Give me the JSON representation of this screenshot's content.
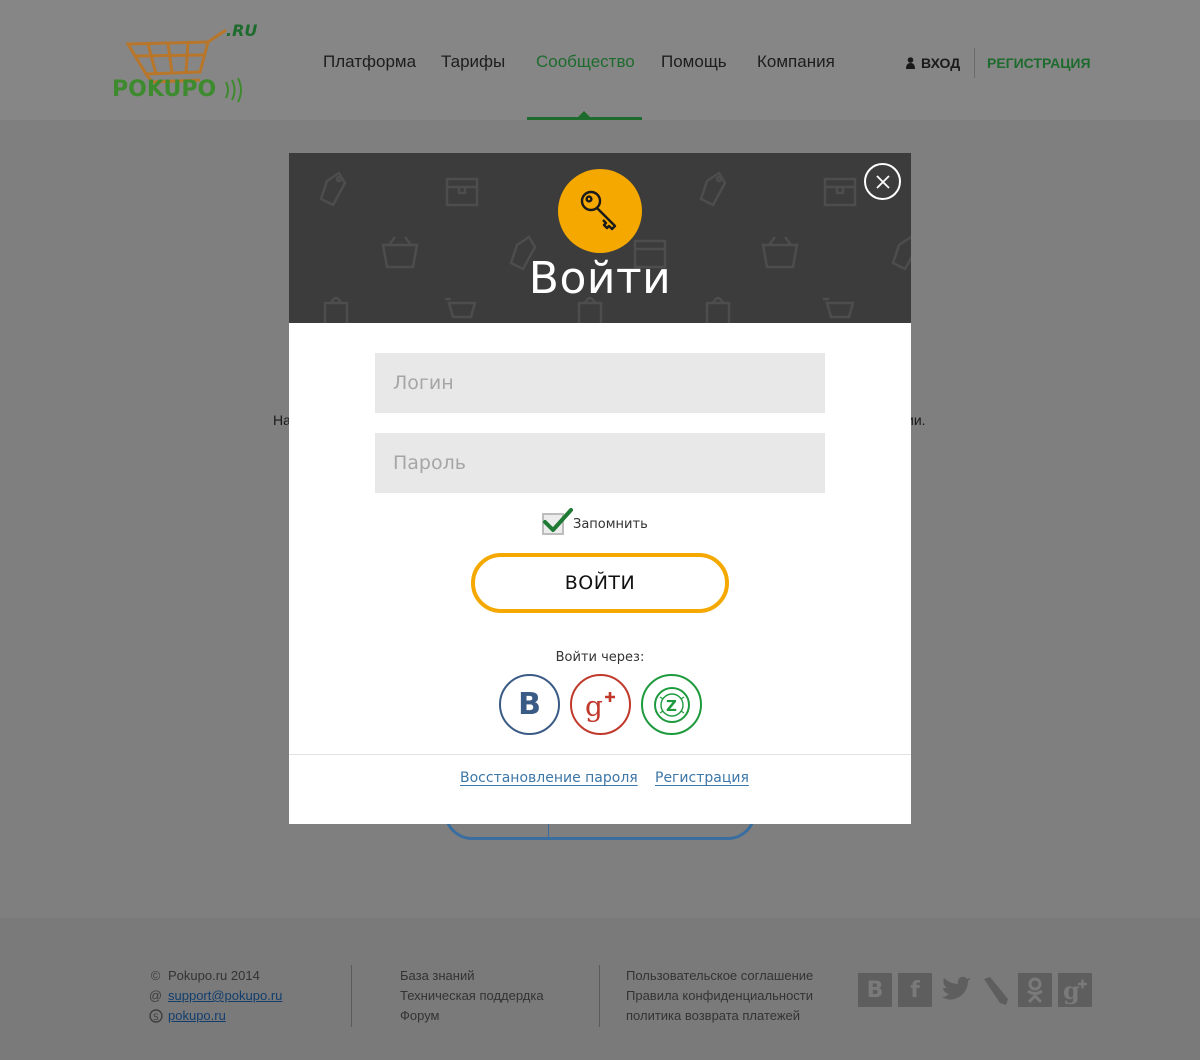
{
  "header": {
    "logo_text": "POKUPO",
    "logo_suffix": ".RU",
    "nav": [
      {
        "label": "Платформа"
      },
      {
        "label": "Тарифы"
      },
      {
        "label": "Сообщество"
      },
      {
        "label": "Помощь"
      },
      {
        "label": "Компания"
      }
    ],
    "active_nav": "Сообщество",
    "login_label": "ВХОД",
    "register_label": "РЕГИСТРАЦИЯ"
  },
  "background": {
    "text_left": "На",
    "text_right": "ии."
  },
  "modal": {
    "title": "Войти",
    "login_placeholder": "Логин",
    "password_placeholder": "Пароль",
    "remember_label": "Запомнить",
    "remember_checked": true,
    "submit_label": "ВОЙТИ",
    "via_label": "Войти через:",
    "social": [
      {
        "name": "vk",
        "glyph": "B"
      },
      {
        "name": "google-plus",
        "glyph": "g+"
      },
      {
        "name": "z-payment",
        "glyph": "Z"
      }
    ],
    "recover_link": "Восстановление пароля",
    "register_link": "Регистрация"
  },
  "footer": {
    "col1": {
      "copyright": "Pokupo.ru 2014",
      "email": "support@pokupo.ru",
      "skype": "pokupo.ru"
    },
    "col2": [
      "База знаний",
      "Техническая поддердка",
      "Форум"
    ],
    "col3": [
      "Пользовательское соглашение",
      "Правила конфиденциальности",
      "политика возврата платежей"
    ],
    "social_icons": [
      "vk-icon",
      "facebook-icon",
      "twitter-icon",
      "livejournal-icon",
      "odnoklassniki-icon",
      "google-plus-icon"
    ]
  },
  "colors": {
    "accent_green": "#1e6b2e",
    "accent_orange": "#f4a800",
    "link_blue": "#3d77a8",
    "modal_head": "#3c3c3c"
  }
}
